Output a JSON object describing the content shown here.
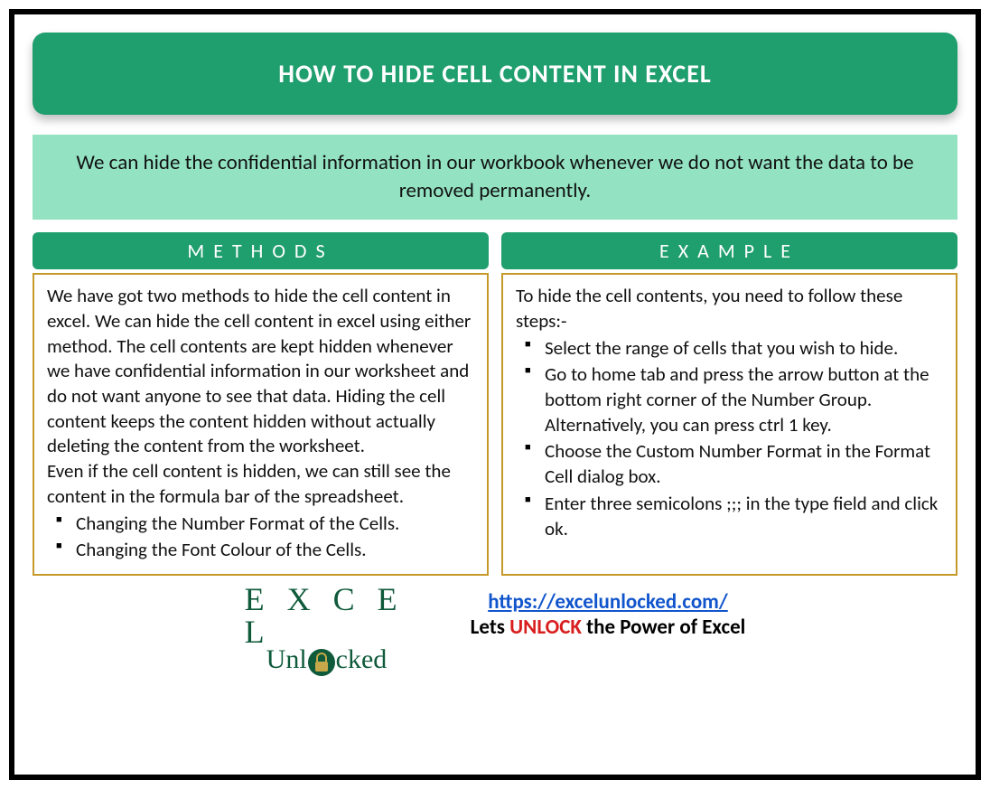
{
  "title": "HOW TO HIDE CELL CONTENT IN EXCEL",
  "intro": "We can hide the confidential information in our workbook whenever we do not want the data to be removed permanently.",
  "left": {
    "header": "METHODS",
    "para1": "We have got two methods to hide the cell content in excel. We can hide the cell content in excel using either method. The cell contents are kept hidden whenever we have confidential information in our worksheet and do not want anyone to see that data. Hiding the cell content keeps the content hidden without actually deleting the content from the worksheet.",
    "para2": "Even if the cell content is hidden, we can still see the content in the formula bar of the spreadsheet.",
    "bullets": [
      "Changing the Number Format of the Cells.",
      "Changing the Font Colour of the Cells."
    ]
  },
  "right": {
    "header": "EXAMPLE",
    "para": "To hide the cell contents, you need to follow these steps:-",
    "bullets": [
      "Select the range of cells that you wish to hide.",
      "Go to home tab and press the arrow button at the bottom right corner of the Number Group. Alternatively, you can press ctrl 1 key.",
      "Choose the Custom Number Format in the Format Cell dialog box.",
      "Enter three semicolons ;;; in the type field and click ok."
    ]
  },
  "footer": {
    "logo_top": "E X C E L",
    "logo_pre": "Unl",
    "logo_post": "cked",
    "url": "https://excelunlocked.com/",
    "tag_pre": "Lets ",
    "tag_unlock": "UNLOCK",
    "tag_post": " the Power of Excel"
  }
}
